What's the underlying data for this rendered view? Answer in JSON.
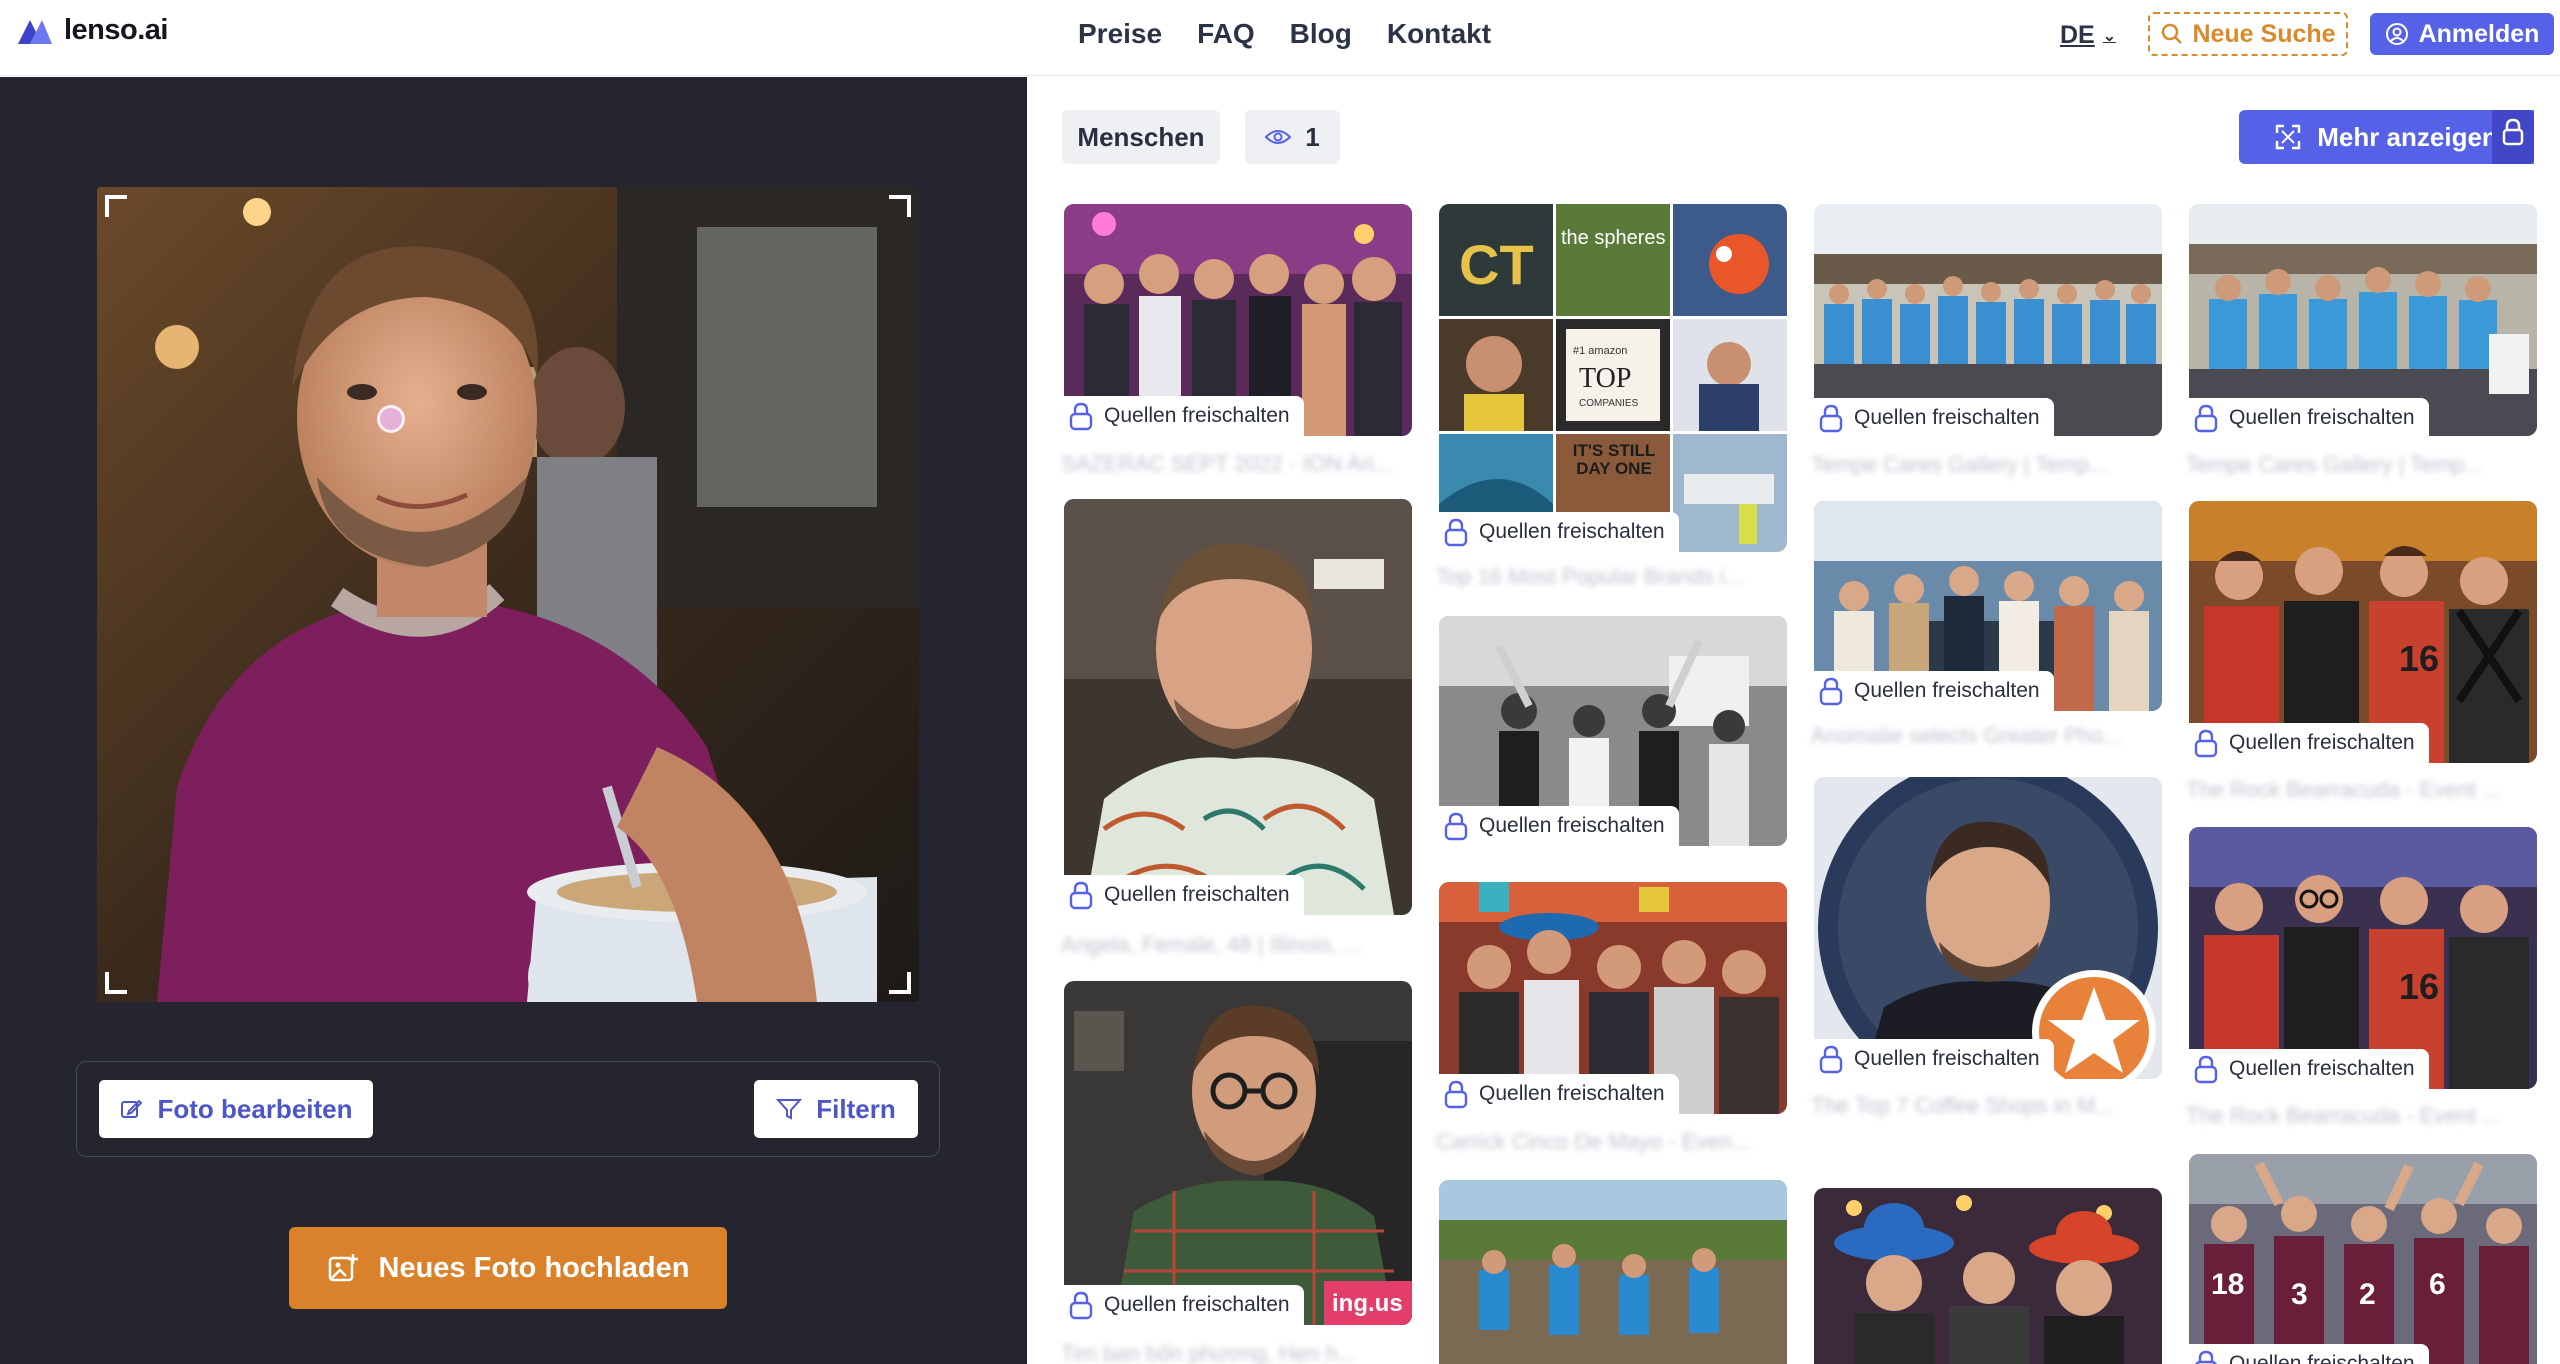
{
  "brand": {
    "name": "lenso.ai"
  },
  "nav": {
    "items": [
      "Preise",
      "FAQ",
      "Blog",
      "Kontakt"
    ]
  },
  "header": {
    "language": "DE",
    "new_search_label": "Neue Suche",
    "login_label": "Anmelden"
  },
  "left_panel": {
    "edit_label": "Foto bearbeiten",
    "filter_label": "Filtern",
    "upload_label": "Neues Foto hochladen"
  },
  "results": {
    "people_chip": "Menschen",
    "view_count": "1",
    "more_label": "Mehr anzeigen",
    "badge_label": "Quellen freischalten",
    "captions": [
      "SAZERAC SEPT 2022 - ION Ari...",
      "Top 16 Most Popular Brands i...",
      "Tempe Cares Gallery | Temp...",
      "Tempe Cares Gallery | Temp...",
      "Angela, Female, 48 | Illinois, ...",
      "Anomalie selects Greater Pho...",
      "The Rock Bearracuda - Event ...",
      "Carrick Cinco De Mayo - Even...",
      "The Top 7 Coffee Shops in M...",
      "The Rock Bearracuda - Event ...",
      "Tim ban bốn phương, Hẹn h..."
    ],
    "collage_texts": [
      "the spheres",
      "#1 amazon",
      "TOP",
      "COMPANIES",
      "IT'S STILL DAY ONE"
    ],
    "watermark_text": "ing.us"
  },
  "colors": {
    "brand": "#5561e7",
    "accent": "#d9822b",
    "panel_dark": "#242530"
  }
}
